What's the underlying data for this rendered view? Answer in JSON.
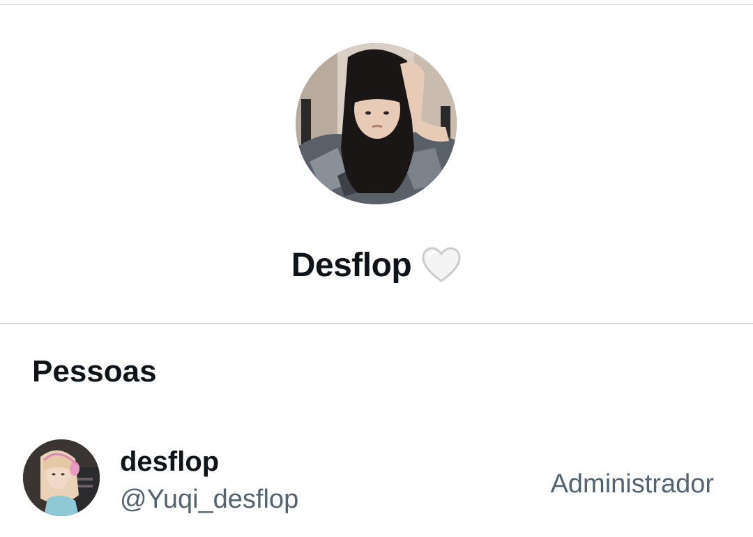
{
  "group": {
    "name": "Desflop",
    "avatar_icon": "group-photo-avatar",
    "emoji_icon": "white-heart-icon"
  },
  "people_section": {
    "heading": "Pessoas",
    "members": [
      {
        "display_name": "desflop",
        "handle": "@Yuqi_desflop",
        "role": "Administrador",
        "avatar_icon": "user-photo-avatar"
      }
    ]
  },
  "colors": {
    "primary_text": "#0f1419",
    "secondary_text": "#536471",
    "divider": "#d7dadd",
    "background": "#ffffff"
  }
}
